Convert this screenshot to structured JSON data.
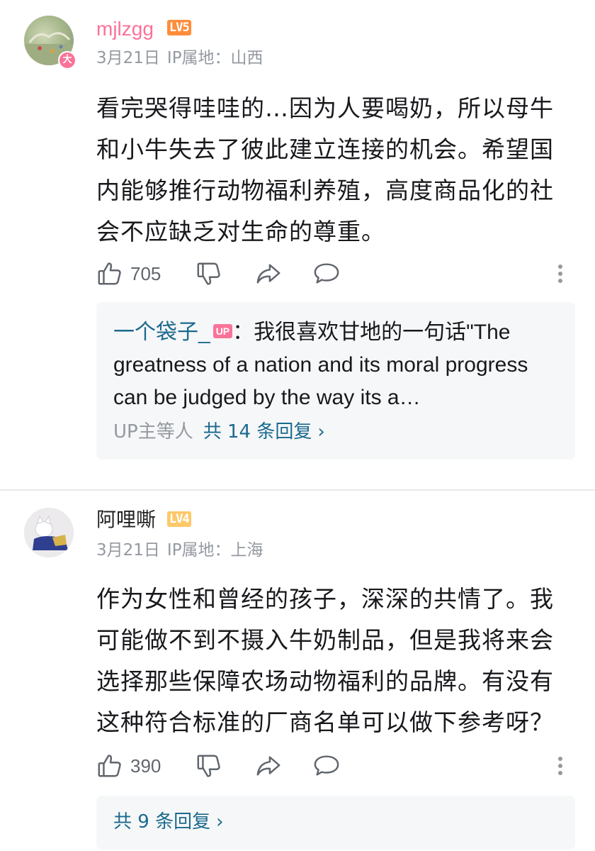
{
  "comments": [
    {
      "username": "mjlzgg",
      "level": "LV5",
      "avatar_badge": "大",
      "date": "3月21日",
      "ip": "IP属地：山西",
      "text": "看完哭得哇哇的…因为人要喝奶，所以母牛和小牛失去了彼此建立连接的机会。希望国内能够推行动物福利养殖，高度商品化的社会不应缺乏对生命的尊重。",
      "likes": "705",
      "sub_reply": {
        "user": "一个袋子_",
        "tag": "UP",
        "text": "：我很喜欢甘地的一句话\"The greatness of a nation and its moral progress can be judged by the way its a…"
      },
      "more_prefix": "UP主等人",
      "more_link": "共 14 条回复"
    },
    {
      "username": "阿哩嘶",
      "level": "LV4",
      "date": "3月21日",
      "ip": "IP属地：上海",
      "text": "作为女性和曾经的孩子，深深的共情了。我可能做不到不摄入牛奶制品，但是我将来会选择那些保障农场动物福利的品牌。有没有这种符合标准的厂商名单可以做下参考呀？",
      "likes": "390",
      "more_link": "共 9 条回复"
    }
  ],
  "icons": [
    "thumbs-up-icon",
    "thumbs-down-icon",
    "share-icon",
    "reply-icon",
    "more-icon",
    "chevron-right-icon"
  ]
}
